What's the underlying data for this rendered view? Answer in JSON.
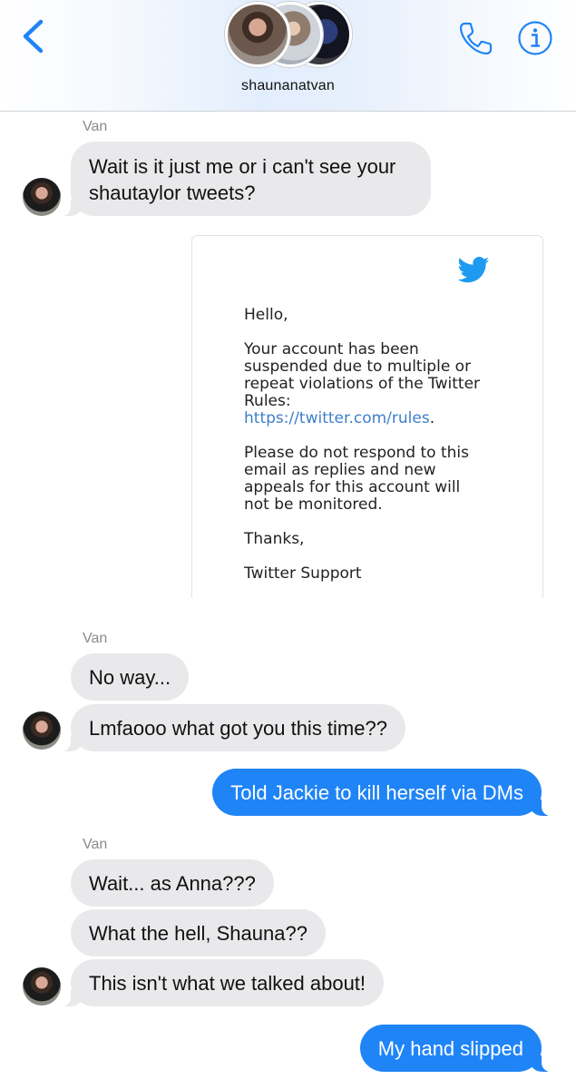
{
  "header": {
    "chat_name": "shaunanatvan",
    "back_icon": "chevron-left-icon",
    "call_icon": "phone-icon",
    "info_icon": "info-icon",
    "accent_color": "#1f84f6"
  },
  "messages": {
    "sender_1": "Van",
    "m1": "Wait is it just me or i can't see your",
    "m1b": "shautaylor tweets?",
    "sender_2": "Van",
    "m2": "No way...",
    "m3": "Lmfaooo what got you this time??",
    "m4": "Told Jackie to kill herself via DMs",
    "sender_3": "Van",
    "m5": "Wait... as Anna???",
    "m6": "What the hell, Shauna??",
    "m7": "This isn't what we talked about!",
    "m8": "My hand slipped"
  },
  "attachment": {
    "icon": "twitter-bird-icon",
    "greeting": "Hello,",
    "para1_l1": "Your account has been",
    "para1_l2": "suspended due to multiple or",
    "para1_l3": "repeat violations of the Twitter",
    "para1_l4": "Rules:",
    "link": "https://twitter.com/rules",
    "link_suffix": ".",
    "para2_l1": "Please do not respond to this",
    "para2_l2": "email as replies and new",
    "para2_l3": "appeals for this account will",
    "para2_l4": "not be monitored.",
    "thanks": "Thanks,",
    "signature": "Twitter Support"
  },
  "colors": {
    "incoming_bubble": "#e9e9eb",
    "outgoing_bubble": "#1f84f6",
    "sender_label": "#8a8a8e",
    "link": "#3e7fc9"
  }
}
